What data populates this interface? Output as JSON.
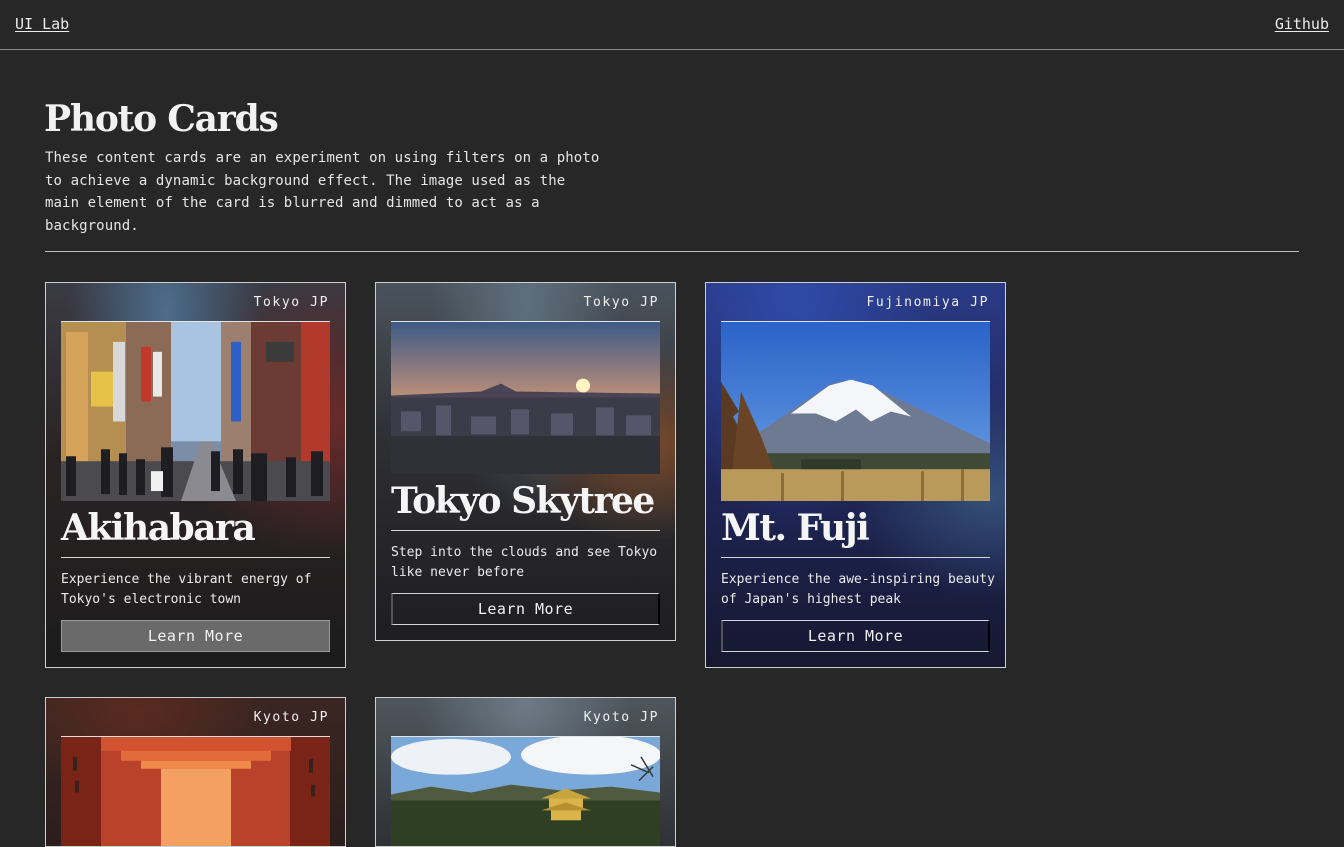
{
  "nav": {
    "home_label": "UI Lab",
    "github_label": "Github"
  },
  "header": {
    "title": "Photo Cards",
    "description": "These content cards are an experiment on using filters on a photo to achieve a dynamic background effect. The image used as the main element of the card is blurred and dimmed to act as a background."
  },
  "cards": [
    {
      "location": "Tokyo JP",
      "title": "Akihabara",
      "description": "Experience the vibrant energy of Tokyo's electronic town",
      "button_label": "Learn More",
      "image": "akihabara-street-photo"
    },
    {
      "location": "Tokyo JP",
      "title": "Tokyo Skytree",
      "description": "Step into the clouds and see Tokyo like never before",
      "button_label": "Learn More",
      "image": "tokyo-sunset-skyline-photo"
    },
    {
      "location": "Fujinomiya JP",
      "title": "Mt. Fuji",
      "description": "Experience the awe-inspiring beauty of Japan's highest peak",
      "button_label": "Learn More",
      "image": "mount-fuji-photo"
    },
    {
      "location": "Kyoto JP",
      "image": "torii-gates-photo"
    },
    {
      "location": "Kyoto JP",
      "image": "kinkakuji-temple-photo"
    }
  ],
  "colors": {
    "background": "#272727",
    "text": "#ececec",
    "button_active": "#6a6a6a"
  }
}
